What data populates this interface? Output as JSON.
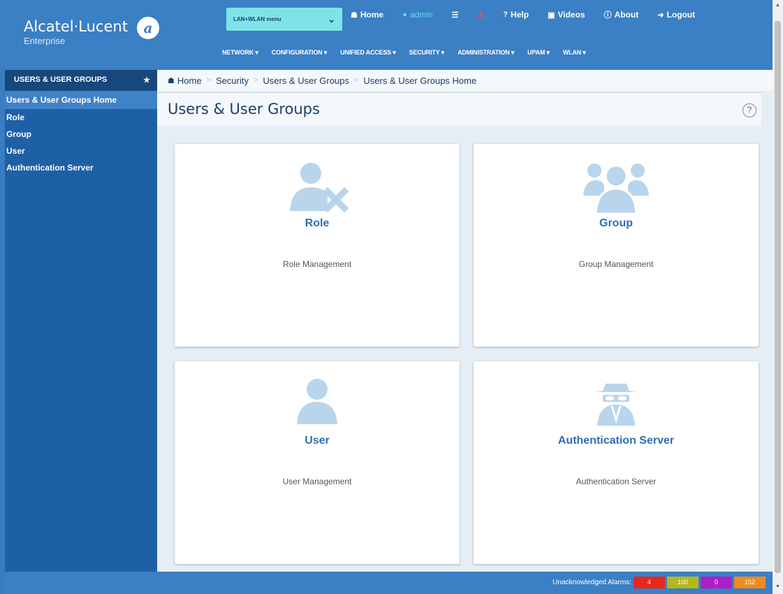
{
  "brand": {
    "name": "Alcatel·Lucent",
    "sub": "Enterprise"
  },
  "context_select": {
    "value": "LAN+WLAN menu"
  },
  "topnav": {
    "home": "Home",
    "user": "admin",
    "help": "Help",
    "videos": "Videos",
    "about": "About",
    "logout": "Logout"
  },
  "mainmenu": [
    "NETWORK",
    "CONFIGURATION",
    "UNIFIED ACCESS",
    "SECURITY",
    "ADMINISTRATION",
    "UPAM",
    "WLAN"
  ],
  "sidebar": {
    "title": "USERS & USER GROUPS",
    "items": [
      {
        "label": "Users & User Groups Home"
      },
      {
        "label": "Role"
      },
      {
        "label": "Group"
      },
      {
        "label": "User"
      },
      {
        "label": "Authentication Server"
      }
    ]
  },
  "breadcrumb": [
    "Home",
    "Security",
    "Users & User Groups",
    "Users & User Groups Home"
  ],
  "page": {
    "title": "Users & User Groups",
    "help": "?"
  },
  "cards": [
    {
      "title": "Role",
      "desc": "Role Management",
      "icon": "role-icon"
    },
    {
      "title": "Group",
      "desc": "Group Management",
      "icon": "group-icon"
    },
    {
      "title": "User",
      "desc": "User Management",
      "icon": "user-icon"
    },
    {
      "title": "Authentication Server",
      "desc": "Authentication Server",
      "icon": "authentication-server-icon"
    }
  ],
  "footer": {
    "alarms_label": "Unacknowledged Alarms:",
    "alarms": [
      {
        "value": "4",
        "color": "#e8261e"
      },
      {
        "value": "100",
        "color": "#b4b81c"
      },
      {
        "value": "0",
        "color": "#b01ec8"
      },
      {
        "value": "152",
        "color": "#f08a1e"
      }
    ]
  },
  "colors": {
    "accent": "#3b7fc4",
    "sidebar": "#1d60a6",
    "icon": "#b9d5ec"
  }
}
